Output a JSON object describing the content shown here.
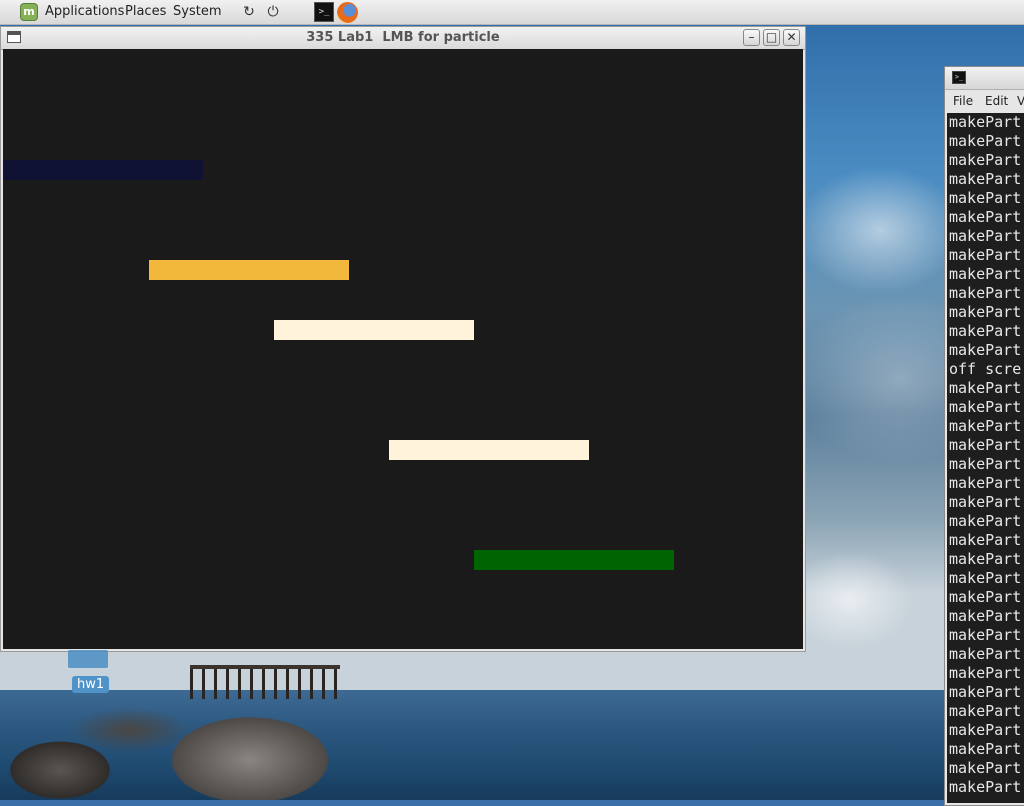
{
  "top_panel": {
    "menus": [
      "Applications",
      "Places",
      "System"
    ],
    "icons": [
      "mint-logo-icon",
      "refresh-icon",
      "power-icon",
      "terminal-launcher-icon",
      "firefox-launcher-icon"
    ]
  },
  "app_window": {
    "title": "335 Lab1  LMB for particle",
    "buttons": [
      "minimize",
      "maximize",
      "close"
    ],
    "particles": [
      {
        "color": "#0f1232"
      },
      {
        "color": "#f2b83c"
      },
      {
        "color": "#fff3dc"
      },
      {
        "color": "#fff3dc"
      },
      {
        "color": "#006400"
      }
    ]
  },
  "terminal_window": {
    "menus": [
      "File",
      "Edit",
      "V"
    ],
    "output_lines": [
      "makePart",
      "makePart",
      "makePart",
      "makePart",
      "makePart",
      "makePart",
      "makePart",
      "makePart",
      "makePart",
      "makePart",
      "makePart",
      "makePart",
      "makePart",
      "off scre",
      "makePart",
      "makePart",
      "makePart",
      "makePart",
      "makePart",
      "makePart",
      "makePart",
      "makePart",
      "makePart",
      "makePart",
      "makePart",
      "makePart",
      "makePart",
      "makePart",
      "makePart",
      "makePart",
      "makePart",
      "makePart",
      "makePart",
      "makePart",
      "makePart",
      "makePart"
    ]
  },
  "desktop": {
    "icons": [
      {
        "label": "hw1"
      }
    ]
  }
}
